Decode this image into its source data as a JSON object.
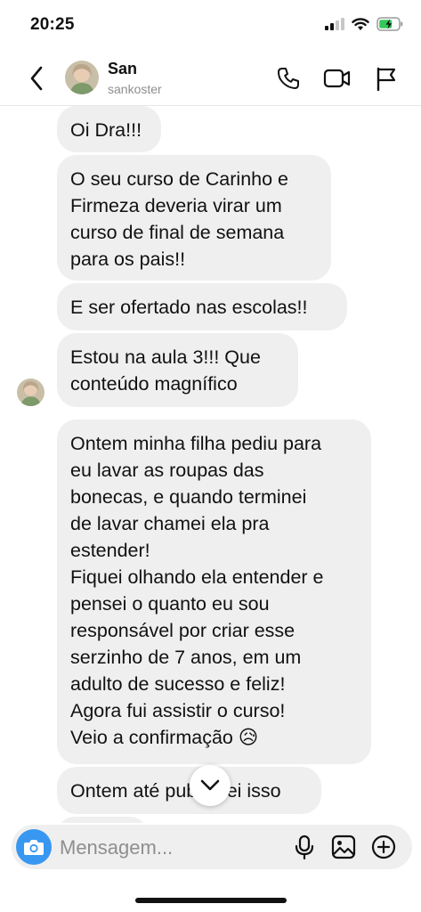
{
  "status_bar": {
    "time": "20:25"
  },
  "header": {
    "name": "San",
    "username": "sankoster"
  },
  "messages": [
    {
      "text": "Oi Dra!!!"
    },
    {
      "text": "O seu curso de Carinho e\nFirmeza deveria virar um\ncurso de final de semana\npara os pais!!"
    },
    {
      "text": "E ser ofertado nas escolas!!"
    },
    {
      "text": "Estou na aula 3!!! Que\nconteúdo magnífico"
    },
    {
      "text": "Ontem minha filha pediu para\neu lavar as roupas das\nbonecas, e quando terminei\nde lavar chamei ela pra\nestender!\nFiquei olhando ela entender e\npensei o quanto eu sou\nresponsável por criar esse\nserzinho de 7 anos, em um\nadulto de sucesso e feliz!\nAgora fui assistir o curso!\nVeio a confirmação 😥"
    },
    {
      "text": "Ontem até publiquei isso"
    }
  ],
  "composer": {
    "placeholder": "Mensagem..."
  },
  "colors": {
    "bubble": "#efefef",
    "accent": "#3897f0",
    "battery": "#34c759"
  },
  "icons": [
    "back-icon",
    "phone-icon",
    "video-icon",
    "flag-icon",
    "camera-icon",
    "mic-icon",
    "image-icon",
    "plus-circle-icon",
    "chevron-down-icon"
  ]
}
